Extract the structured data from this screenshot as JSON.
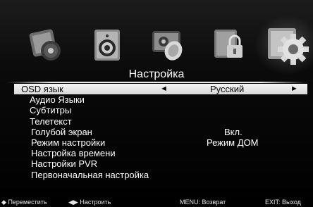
{
  "menu": {
    "title": "Настройка",
    "icons": [
      "picture-icon",
      "sound-icon",
      "channel-icon",
      "lock-icon",
      "setup-gear-icon"
    ],
    "selected_icon_index": 4
  },
  "rows": [
    {
      "label": "OSD язык",
      "value": "Русский",
      "selected": true,
      "arrow_left": "◄",
      "arrow_right": "►"
    },
    {
      "label": "Аудио Языки",
      "value": ""
    },
    {
      "label": "Субтитры",
      "value": ""
    },
    {
      "label": "Телетекст",
      "value": ""
    },
    {
      "label": "Голубой экран",
      "value": "Вкл."
    },
    {
      "label": "Режим настройки",
      "value": "Режим ДОМ"
    },
    {
      "label": "Настройка времени",
      "value": ""
    },
    {
      "label": "Настройки PVR",
      "value": ""
    },
    {
      "label": "Первоначальная настройка",
      "value": ""
    }
  ],
  "footer": {
    "move_icon": "◆",
    "move": "Переместить",
    "adjust_icon": "◀▶",
    "adjust": "Настроить",
    "menu": "MENU: Возврат",
    "exit": "EXIT: Выход"
  },
  "colors": {
    "background": "#000000",
    "highlight": "#e6e6e6",
    "text": "#ffffff",
    "selected_text": "#000000"
  }
}
